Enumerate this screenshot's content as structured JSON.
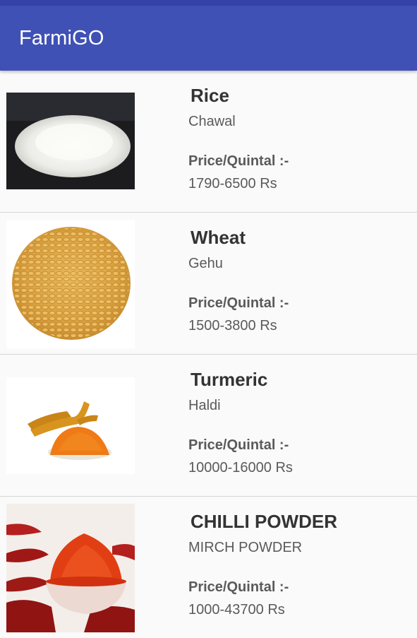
{
  "app": {
    "title": "FarmiGO"
  },
  "products": [
    {
      "name": "Rice",
      "local_name": "Chawal",
      "price_label": "Price/Quintal :-",
      "price": "1790-6500 Rs",
      "image": "rice-image"
    },
    {
      "name": "Wheat",
      "local_name": "Gehu",
      "price_label": "Price/Quintal :-",
      "price": "1500-3800 Rs",
      "image": "wheat-image"
    },
    {
      "name": "Turmeric",
      "local_name": "Haldi",
      "price_label": "Price/Quintal :-",
      "price": "10000-16000 Rs",
      "image": "turmeric-image"
    },
    {
      "name": "CHILLI POWDER",
      "local_name": "MIRCH POWDER",
      "price_label": "Price/Quintal :-",
      "price": "1000-43700 Rs",
      "image": "chilli-powder-image"
    }
  ],
  "colors": {
    "app_bar": "#4051b5",
    "status_bar": "#3443a8",
    "background": "#fafafa"
  }
}
